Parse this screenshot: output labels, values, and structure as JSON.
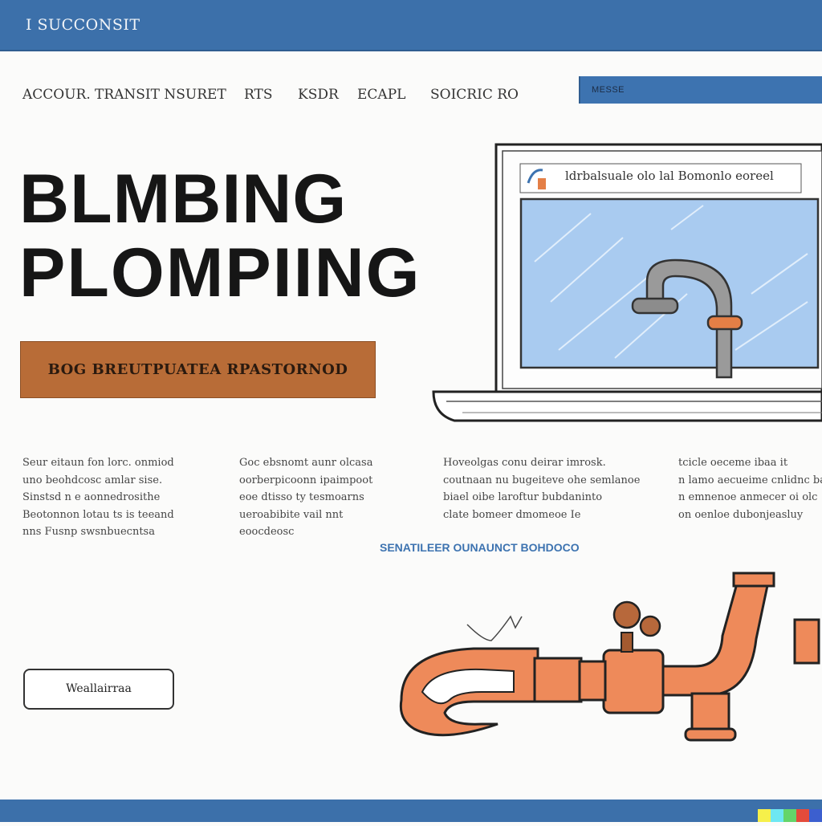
{
  "topbar": {
    "brand": "I SUCCONSIT"
  },
  "nav": {
    "items": [
      "ACCOUR.",
      "TRANSIT NSURET",
      "RTS",
      "KSDR",
      "ECAPL",
      "SOICRIC RO"
    ],
    "cta_label": "MESSE"
  },
  "hero": {
    "title_line1": "BLMBING",
    "title_line2": "PLOMPIING",
    "cta_label": "BOG BREUTPUATEA RPASTORNOD"
  },
  "laptop": {
    "browser_text": "ldrbalsuale olo lal Bomonlo eoreel"
  },
  "columns": [
    {
      "lines": [
        "Seur eitaun fon lorc. onmiod",
        "uno beohdcosc amlar sise.",
        "Sinstsd n e aonnedrosithe",
        "Beotonnon lotau ts is teeand",
        "nns Fusnp swsnbuecntsa"
      ]
    },
    {
      "lines": [
        "Goc ebsnomt aunr olcasa",
        "oorberpicoonn ipaimpoot",
        "eoe dtisso ty tesmoarns",
        "ueroabibite vail nnt",
        "eoocdeosc"
      ]
    },
    {
      "lines": [
        "Hoveolgas conu deirar imrosk.",
        "coutnaan nu bugeiteve ohe semlanoe",
        "biael oibe laroftur bubdaninto",
        "clate bomeer dmomeoe Ie"
      ]
    },
    {
      "lines": [
        "tcicle oeceme ibaa it",
        "n lamo aecueime cnlidnc bavbutn",
        "n emnenoe anmecer oi olc",
        "on oenloe dubonjeasluy"
      ]
    }
  ],
  "center_link": "SENATILEER OUNAUNCT BOHDOCO",
  "outline_button": "Weallairraa",
  "colors": {
    "header_blue": "#3c70aa",
    "accent_orange": "#b86c37",
    "pipe_orange": "#ee8a5a",
    "screen_blue": "#a9cbf0"
  },
  "icons": [
    "faucet-icon",
    "wrench-pipe-illustration",
    "laptop-illustration"
  ]
}
